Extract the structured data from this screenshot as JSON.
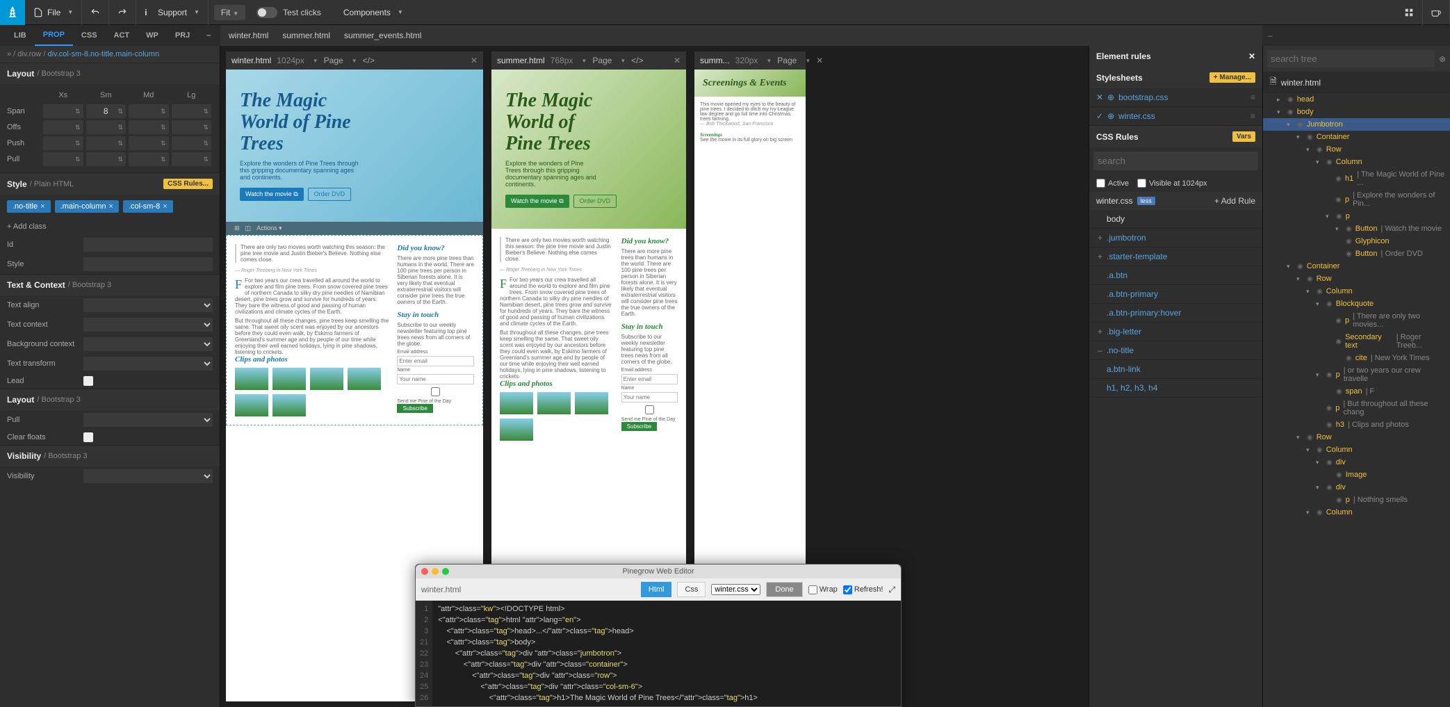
{
  "topbar": {
    "file": "File",
    "support": "Support",
    "fit": "Fit",
    "test_clicks": "Test clicks",
    "components": "Components"
  },
  "panel_tabs": [
    "LIB",
    "PROP",
    "CSS",
    "ACT",
    "WP",
    "PRJ"
  ],
  "panel_tabs_active": "PROP",
  "file_tabs": [
    "winter.html",
    "summer.html",
    "summer_events.html"
  ],
  "breadcrumb": {
    "root": "div.row",
    "current": "div.col-sm-8.no-title.main-column"
  },
  "layout": {
    "title": "Layout",
    "sub": "/ Bootstrap 3",
    "cols": [
      "Xs",
      "Sm",
      "Md",
      "Lg"
    ],
    "rows": [
      "Span",
      "Offs",
      "Push",
      "Pull"
    ],
    "span_sm": "8"
  },
  "style": {
    "title": "Style",
    "sub": "/ Plain HTML",
    "badge": "CSS Rules...",
    "chips": [
      ".no-title",
      ".main-column",
      ".col-sm-8"
    ],
    "add_class": "+ Add class",
    "id_lbl": "Id",
    "style_lbl": "Style"
  },
  "textcontext": {
    "title": "Text & Context",
    "sub": "/ Bootstrap 3",
    "rows": [
      "Text align",
      "Text context",
      "Background context",
      "Text transform",
      "Lead"
    ]
  },
  "layout2": {
    "title": "Layout",
    "sub": "/ Bootstrap 3",
    "rows": [
      "Pull",
      "Clear floats"
    ]
  },
  "visibility": {
    "title": "Visibility",
    "sub": "/ Bootstrap 3",
    "rows": [
      "Visibility"
    ]
  },
  "previews": [
    {
      "name": "winter.html",
      "dim": "1024px",
      "page": "Page"
    },
    {
      "name": "summer.html",
      "dim": "768px",
      "page": "Page"
    },
    {
      "name": "summ...",
      "dim": "320px",
      "page": "Page"
    }
  ],
  "jumbo": {
    "title": "The Magic World of Pine Trees",
    "subtitle": "Explore the wonders of Pine Trees through this gripping documentary spanning ages and continents.",
    "btn1": "Watch the movie ⧉",
    "btn2": "Order DVD"
  },
  "article": {
    "quote": "There are only two movies worth watching this season: the pine tree movie and Justin Bieber's Believe. Nothing else comes close.",
    "cite": "— Roger Treeberg in New York Times",
    "p1": "For two years our crew travelled all around the world to explore and film pine trees. From snow covered pine trees of northern Canada to silky dry pine needles of Namibian desert, pine trees grow and survive for hundreds of years. They bare the witness of good and passing of human civilizations and climate cycles of the Earth.",
    "p2": "But throughout all these changes, pine trees keep smelling the same. That sweet oily scent was enjoyed by our ancestors before they could even walk, by Eskimo farmers of Greenland's summer age and by people of our time while enjoying their well earned holidays, lying in pine shadows, listening to crickets.",
    "clips": "Clips and photos",
    "did": "Did you know?",
    "didtxt": "There are more pine trees than humans in the world. There are 100 pine trees per person in Siberian forests alone. It is very likely that eventual extraterrestrial visitors will consider pine trees the true owners of the Earth.",
    "stay": "Stay in touch",
    "staytxt": "Subscribe to our weekly newsletter featuring top pine trees news from all corners of the globe.",
    "email_lbl": "Email address",
    "email_ph": "Enter email",
    "name_lbl": "Name",
    "name_ph": "Your name",
    "cb_lbl": "Send me Pine of the Day",
    "sub_btn": "Subscribe"
  },
  "small_preview": {
    "title": "Screenings & Events",
    "quote": "This movie opened my eyes to the beauty of pine trees. I decided to ditch my Ivy League law degree and go full time into Christmas trees farming.",
    "cite": "— Bob Thickwood, San Francisco",
    "hdr": "Screenings",
    "txt": "See the movie in its full glory on big screen"
  },
  "element_rules": {
    "title": "Element rules",
    "stylesheets": "Stylesheets",
    "manage": "+ Manage...",
    "sheets": [
      "bootstrap.css",
      "winter.css"
    ],
    "css_rules": "CSS Rules",
    "vars": "Vars",
    "search_ph": "search",
    "filter_active": "Active",
    "filter_visible": "Visible at 1024px",
    "file": "winter.css",
    "file_badge": "less",
    "add_rule": "+ Add Rule",
    "rules": [
      {
        "sel": "body",
        "expand": false
      },
      {
        "sel": ".jumbotron",
        "expand": true
      },
      {
        "sel": ".starter-template",
        "expand": true
      },
      {
        "sel": ".a.btn",
        "expand": false
      },
      {
        "sel": ".a.btn-primary",
        "expand": false
      },
      {
        "sel": ".a.btn-primary:hover",
        "expand": false
      },
      {
        "sel": ".big-letter",
        "expand": true
      },
      {
        "sel": ".no-title",
        "expand": false,
        "minus": true
      },
      {
        "sel": "a.btn-link",
        "expand": false
      },
      {
        "sel": "h1, h2, h3, h4",
        "expand": false
      }
    ]
  },
  "tree": {
    "search_ph": "search tree",
    "file": "winter.html",
    "nodes": [
      {
        "d": 1,
        "tag": "head",
        "arr": "▸"
      },
      {
        "d": 1,
        "tag": "body",
        "arr": "▾"
      },
      {
        "d": 2,
        "tag": "Jumbotron",
        "arr": "▾",
        "sel": true
      },
      {
        "d": 3,
        "tag": "Container",
        "arr": "▾"
      },
      {
        "d": 4,
        "tag": "Row",
        "arr": "▾"
      },
      {
        "d": 5,
        "tag": "Column",
        "arr": "▾"
      },
      {
        "d": 6,
        "tag": "h1",
        "info": "The Magic World of Pine ..."
      },
      {
        "d": 6,
        "tag": "p",
        "info": "Explore the wonders of Pin..."
      },
      {
        "d": 6,
        "tag": "p",
        "arr": "▾"
      },
      {
        "d": 7,
        "tag": "Button",
        "info": "Watch the movie",
        "arr": "▾"
      },
      {
        "d": 7,
        "tag": "Glyphicon",
        "leaf": true
      },
      {
        "d": 7,
        "tag": "Button",
        "info": "Order DVD"
      },
      {
        "d": 2,
        "tag": "Container",
        "arr": "▾"
      },
      {
        "d": 3,
        "tag": "Row",
        "arr": "▾"
      },
      {
        "d": 4,
        "tag": "Column",
        "arr": "▾"
      },
      {
        "d": 5,
        "tag": "Blockquote",
        "arr": "▾"
      },
      {
        "d": 6,
        "tag": "p",
        "info": "There are only two movies..."
      },
      {
        "d": 6,
        "tag": "Secondary text",
        "info": "Roger Treeb..."
      },
      {
        "d": 7,
        "tag": "cite",
        "info": "New York Times"
      },
      {
        "d": 5,
        "tag": "p",
        "info": "or two years our crew travelle",
        "arr": "▾"
      },
      {
        "d": 6,
        "tag": "span",
        "info": "F"
      },
      {
        "d": 5,
        "tag": "p",
        "info": "But throughout all these chang"
      },
      {
        "d": 5,
        "tag": "h3",
        "info": "Clips and photos"
      },
      {
        "d": 3,
        "tag": "Row",
        "arr": "▾"
      },
      {
        "d": 4,
        "tag": "Column",
        "arr": "▾"
      },
      {
        "d": 5,
        "tag": "div",
        "arr": "▾"
      },
      {
        "d": 6,
        "tag": "Image"
      },
      {
        "d": 5,
        "tag": "div",
        "arr": "▾"
      },
      {
        "d": 6,
        "tag": "p",
        "info": "Nothing smells"
      },
      {
        "d": 4,
        "tag": "Column",
        "arr": "▾"
      }
    ]
  },
  "code": {
    "title": "Pinegrow Web Editor",
    "file": "winter.html",
    "tabs": {
      "html": "Html",
      "css": "Css"
    },
    "css_select": "winter.css",
    "done": "Done",
    "wrap": "Wrap",
    "refresh": "Refresh!",
    "lines": [
      "<!DOCTYPE html>",
      "<html lang=\"en\">",
      "    <head>...</head>",
      "    <body>",
      "        <div class=\"jumbotron\">",
      "            <div class=\"container\">",
      "                <div class=\"row\">",
      "                    <div class=\"col-sm-6\">",
      "                        <h1>The Magic World of Pine Trees</h1>"
    ],
    "nums": [
      "1",
      "2",
      "3",
      "21",
      "22",
      "23",
      "24",
      "25",
      "26"
    ]
  }
}
